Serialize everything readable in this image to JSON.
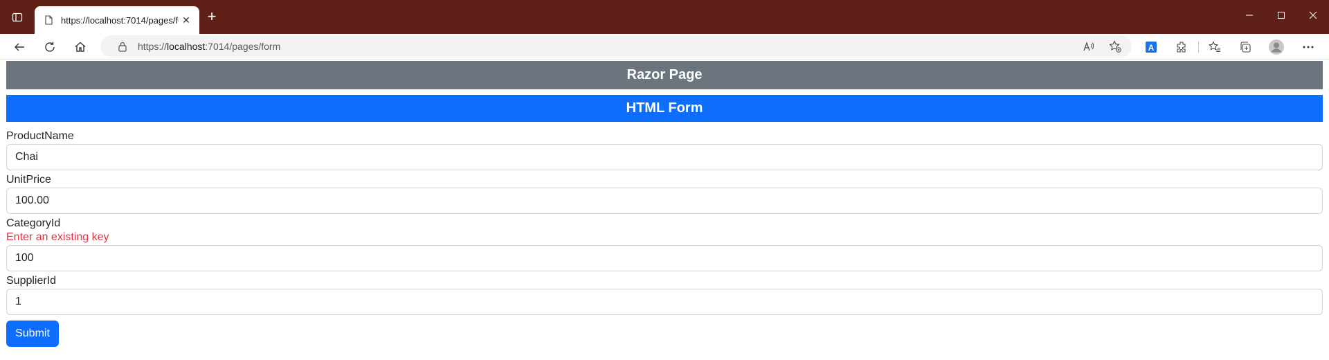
{
  "browser": {
    "tab_title": "https://localhost:7014/pages/form",
    "url_prefix": "https://",
    "url_host": "localhost",
    "url_rest": ":7014/pages/form",
    "titlebar_color": "#5e2017"
  },
  "page": {
    "banner_gray": "Razor Page",
    "banner_blue": "HTML Form",
    "fields": [
      {
        "label": "ProductName",
        "value": "Chai"
      },
      {
        "label": "UnitPrice",
        "value": "100.00"
      },
      {
        "label": "CategoryId",
        "value": "100",
        "error": "Enter an existing key"
      },
      {
        "label": "SupplierId",
        "value": "1"
      }
    ],
    "submit_label": "Submit"
  }
}
